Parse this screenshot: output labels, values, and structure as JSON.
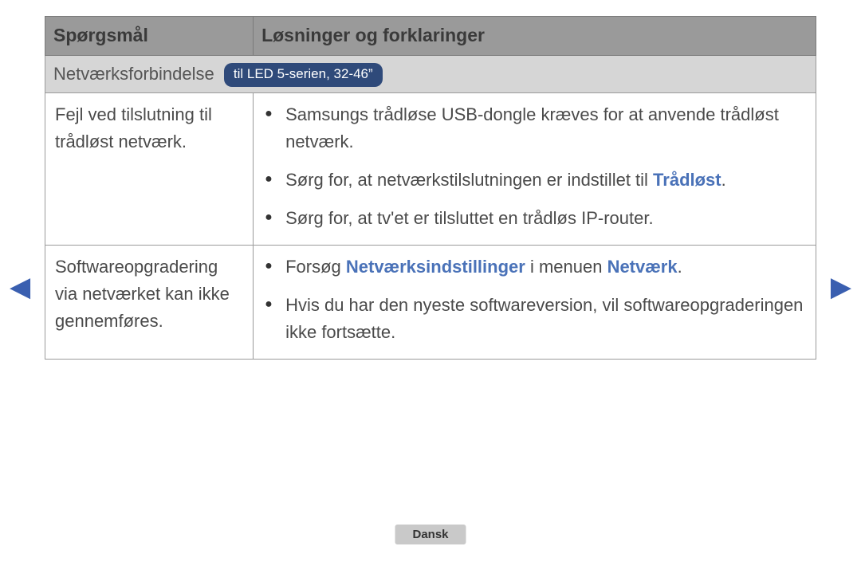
{
  "headers": {
    "question": "Spørgsmål",
    "solutions": "Løsninger og forklaringer"
  },
  "section": {
    "title": "Netværksforbindelse",
    "pill": "til LED 5-serien, 32-46”"
  },
  "rows": [
    {
      "question": "Fejl ved tilslutning til trådløst netværk.",
      "bullets": [
        {
          "pre": "Samsungs trådløse USB-dongle kræves for at anvende trådløst netværk."
        },
        {
          "pre": "Sørg for, at netværkstilslutningen er indstillet til ",
          "hl1": "Trådløst",
          "post": "."
        },
        {
          "pre": "Sørg for, at tv'et er tilsluttet en trådløs IP-router."
        }
      ]
    },
    {
      "question": "Softwareopgradering via netværket kan ikke gennemføres.",
      "bullets": [
        {
          "pre": "Forsøg ",
          "hl1": "Netværksindstillinger",
          "mid": " i menuen ",
          "hl2": "Netværk",
          "post": "."
        },
        {
          "pre": "Hvis du har den nyeste softwareversion, vil softwareopgraderingen ikke fortsætte."
        }
      ]
    }
  ],
  "nav": {
    "prev": "◀",
    "next": "▶"
  },
  "language": "Dansk"
}
